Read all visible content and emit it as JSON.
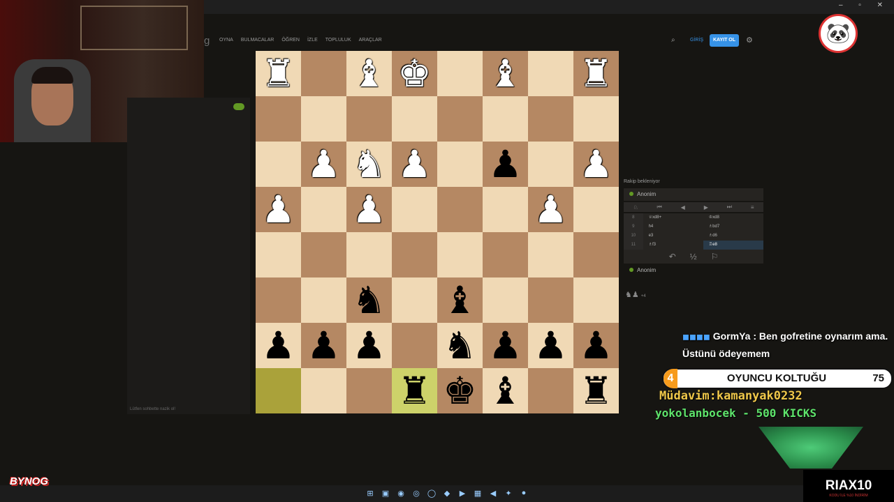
{
  "browser": {
    "controls": "– ▫ ✕"
  },
  "site": {
    "logo_fragment": "g",
    "nav": [
      "OYNA",
      "BULMACALAR",
      "ÖĞREN",
      "İZLE",
      "TOPLULUK",
      "ARAÇLAR"
    ],
    "login": "GİRİŞ",
    "signup": "KAYIT OL",
    "search_icon": "⌕",
    "settings_icon": "⚙"
  },
  "board": {
    "rows": [
      [
        "♜",
        "",
        "♝",
        "♚",
        "",
        "♝",
        "",
        "♜"
      ],
      [
        "",
        "",
        "",
        "",
        "",
        "",
        "",
        ""
      ],
      [
        "",
        "♟",
        "♞",
        "♟",
        "",
        "♟",
        "",
        "♟"
      ],
      [
        "♟",
        "",
        "♟",
        "",
        "",
        "",
        "♟",
        ""
      ],
      [
        "",
        "",
        "",
        "",
        "",
        "",
        "",
        ""
      ],
      [
        "",
        "",
        "♞",
        "",
        "♝",
        "",
        "",
        ""
      ],
      [
        "♟",
        "♟",
        "♟",
        "",
        "♞",
        "♟",
        "♟",
        "♟"
      ],
      [
        "",
        "",
        "",
        "♜",
        "♚",
        "♝",
        "",
        "♜"
      ]
    ],
    "colors": [
      [
        "w",
        "",
        "w",
        "w",
        "",
        "w",
        "",
        "w"
      ],
      [
        "",
        "",
        "",
        "",
        "",
        "",
        "",
        ""
      ],
      [
        "",
        "w",
        "w",
        "w",
        "",
        "b",
        "",
        "w"
      ],
      [
        "w",
        "",
        "w",
        "",
        "",
        "",
        "w",
        ""
      ],
      [
        "",
        "",
        "",
        "",
        "",
        "",
        "",
        ""
      ],
      [
        "",
        "",
        "b",
        "",
        "b",
        "",
        "",
        ""
      ],
      [
        "b",
        "b",
        "b",
        "",
        "b",
        "b",
        "b",
        "b"
      ],
      [
        "",
        "",
        "",
        "b",
        "b",
        "b",
        "",
        "b"
      ]
    ],
    "highlight": [
      [
        7,
        0
      ],
      [
        7,
        3
      ]
    ]
  },
  "game": {
    "status": "Rakip bekleniyor",
    "player_top": "Anonim",
    "player_bottom": "Anonim",
    "controls": [
      "♘",
      "⏮",
      "◀",
      "▶",
      "⏭",
      "≡"
    ],
    "moves": [
      {
        "num": "8",
        "white": "♕xd8+",
        "black": "♔xd8"
      },
      {
        "num": "9",
        "white": "h4",
        "black": "♗bd7"
      },
      {
        "num": "10",
        "white": "e3",
        "black": "♗d6"
      },
      {
        "num": "11",
        "white": "♗f3",
        "black": "♖e8"
      }
    ],
    "actions": [
      "↶",
      "½",
      "⚐"
    ],
    "material": "♞♟",
    "material_score": "+4"
  },
  "chat": {
    "badges": "◼◼◼◼",
    "message": "GormYa : Ben gofretine oynarım ama. Üstünü ödeyemem",
    "placeholder": "Lütfen sohbette nazik ol!"
  },
  "overlay": {
    "goal_number": "4",
    "goal_title": "OYUNCU KOLTUĞU",
    "goal_count": "75",
    "ticker_regular": "Müdavim:kamanyak0232",
    "ticker_kicks": "yokolanbocek - 500 KICKS",
    "stream_logo": "BYNOG",
    "brand": "RIAX10",
    "brand_sub": "KODU İLE %10 İNDİRİM",
    "avatar_icon": "🐼"
  },
  "taskbar": {
    "icons": [
      "⊞",
      "▣",
      "◉",
      "◎",
      "◯",
      "◆",
      "▶",
      "▦",
      "◀",
      "✦",
      "●"
    ]
  }
}
